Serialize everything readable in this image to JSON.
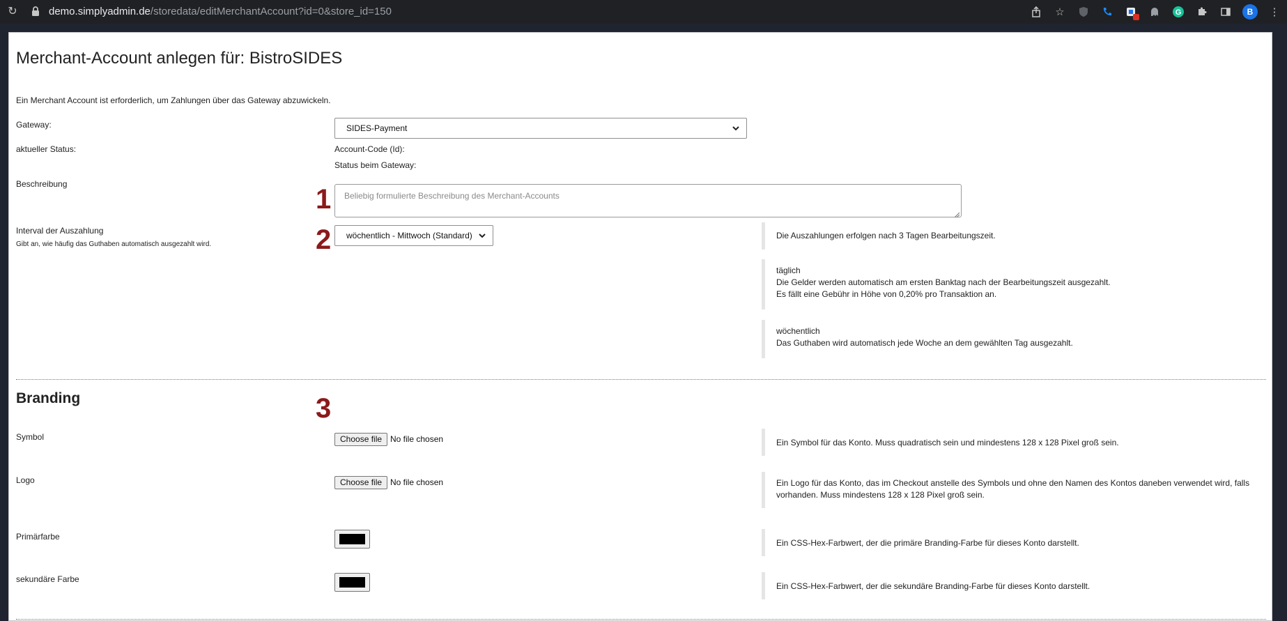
{
  "browser": {
    "url_host": "demo.simplyadmin.de",
    "url_path": "/storedata/editMerchantAccount?id=0&store_id=150",
    "avatar_letter": "B"
  },
  "page": {
    "title": "Merchant-Account anlegen für: BistroSIDES",
    "intro": "Ein Merchant Account ist erforderlich, um Zahlungen über das Gateway abzuwickeln."
  },
  "form": {
    "gateway": {
      "label": "Gateway:",
      "value": "SIDES-Payment"
    },
    "status": {
      "label": "aktueller Status:",
      "account_code_label": "Account-Code (Id):",
      "gateway_status_label": "Status beim Gateway:"
    },
    "description": {
      "label": "Beschreibung",
      "placeholder": "Beliebig formulierte Beschreibung des Merchant-Accounts",
      "value": ""
    },
    "interval": {
      "label": "Interval der Auszahlung",
      "sublabel": "Gibt an, wie häufig das Guthaben automatisch ausgezahlt wird.",
      "value": "wöchentlich - Mittwoch (Standard)",
      "help": {
        "processing": "Die Auszahlungen erfolgen nach 3 Tagen Bearbeitungszeit.",
        "daily_title": "täglich",
        "daily_line1": "Die Gelder werden automatisch am ersten Banktag nach der Bearbeitungszeit ausgezahlt.",
        "daily_line2": "Es fällt eine Gebühr in Höhe von 0,20% pro Transaktion an.",
        "weekly_title": "wöchentlich",
        "weekly_line1": "Das Guthaben wird automatisch jede Woche an dem gewählten Tag ausgezahlt."
      }
    }
  },
  "markers": {
    "one": "1",
    "two": "2",
    "three": "3"
  },
  "branding": {
    "title": "Branding",
    "symbol": {
      "label": "Symbol",
      "button": "Choose file",
      "status": "No file chosen",
      "help": "Ein Symbol für das Konto. Muss quadratisch sein und mindestens 128 x 128 Pixel groß sein."
    },
    "logo": {
      "label": "Logo",
      "button": "Choose file",
      "status": "No file chosen",
      "help_line1": "Ein Logo für das Konto, das im Checkout anstelle des Symbols und ohne den Namen des Kontos daneben verwendet wird, falls",
      "help_line2": "vorhanden. Muss mindestens 128 x 128 Pixel groß sein."
    },
    "primary_color": {
      "label": "Primärfarbe",
      "value": "#000000",
      "help": "Ein CSS-Hex-Farbwert, der die primäre Branding-Farbe für dieses Konto darstellt."
    },
    "secondary_color": {
      "label": "sekundäre Farbe",
      "value": "#000000",
      "help": "Ein CSS-Hex-Farbwert, der die sekundäre Branding-Farbe für dieses Konto darstellt."
    }
  },
  "colors": {
    "marker": "#8b1a1a",
    "chrome_bg": "#202124",
    "avatar": "#1a73e8"
  }
}
